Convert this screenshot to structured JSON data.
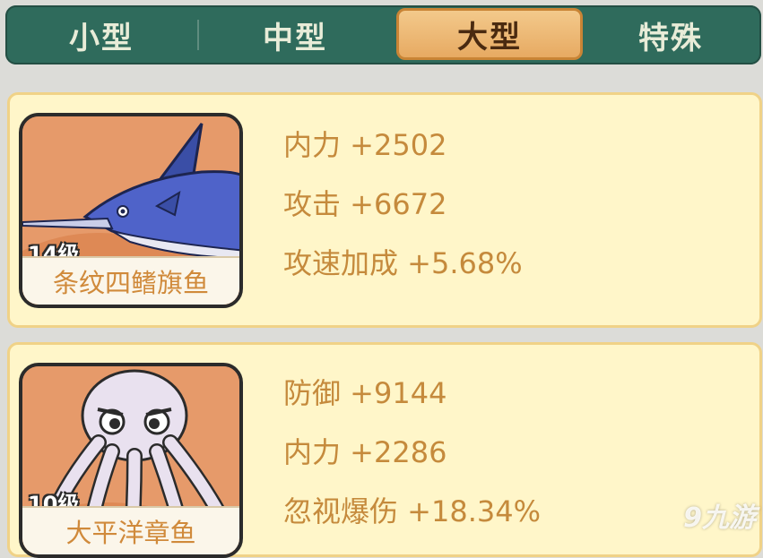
{
  "tabs": [
    {
      "label": "小型",
      "active": false
    },
    {
      "label": "中型",
      "active": false
    },
    {
      "label": "大型",
      "active": true
    },
    {
      "label": "特殊",
      "active": false
    }
  ],
  "fish": [
    {
      "name": "条纹四鳍旗鱼",
      "level": "14级",
      "icon": "marlin-icon",
      "stats": [
        "内力 +2502",
        "攻击 +6672",
        "攻速加成 +5.68%"
      ]
    },
    {
      "name": "大平洋章鱼",
      "level": "10级",
      "icon": "octopus-icon",
      "stats": [
        "防御 +9144",
        "内力 +2286",
        "忽视爆伤 +18.34%"
      ]
    }
  ],
  "colors": {
    "tab_bg": "#2f6b5c",
    "tab_active": "#e7aa62",
    "card_bg": "#fff6c9",
    "stat_text": "#c58a3c",
    "portrait_bg": "#e69a6a"
  },
  "watermark": "9九游"
}
